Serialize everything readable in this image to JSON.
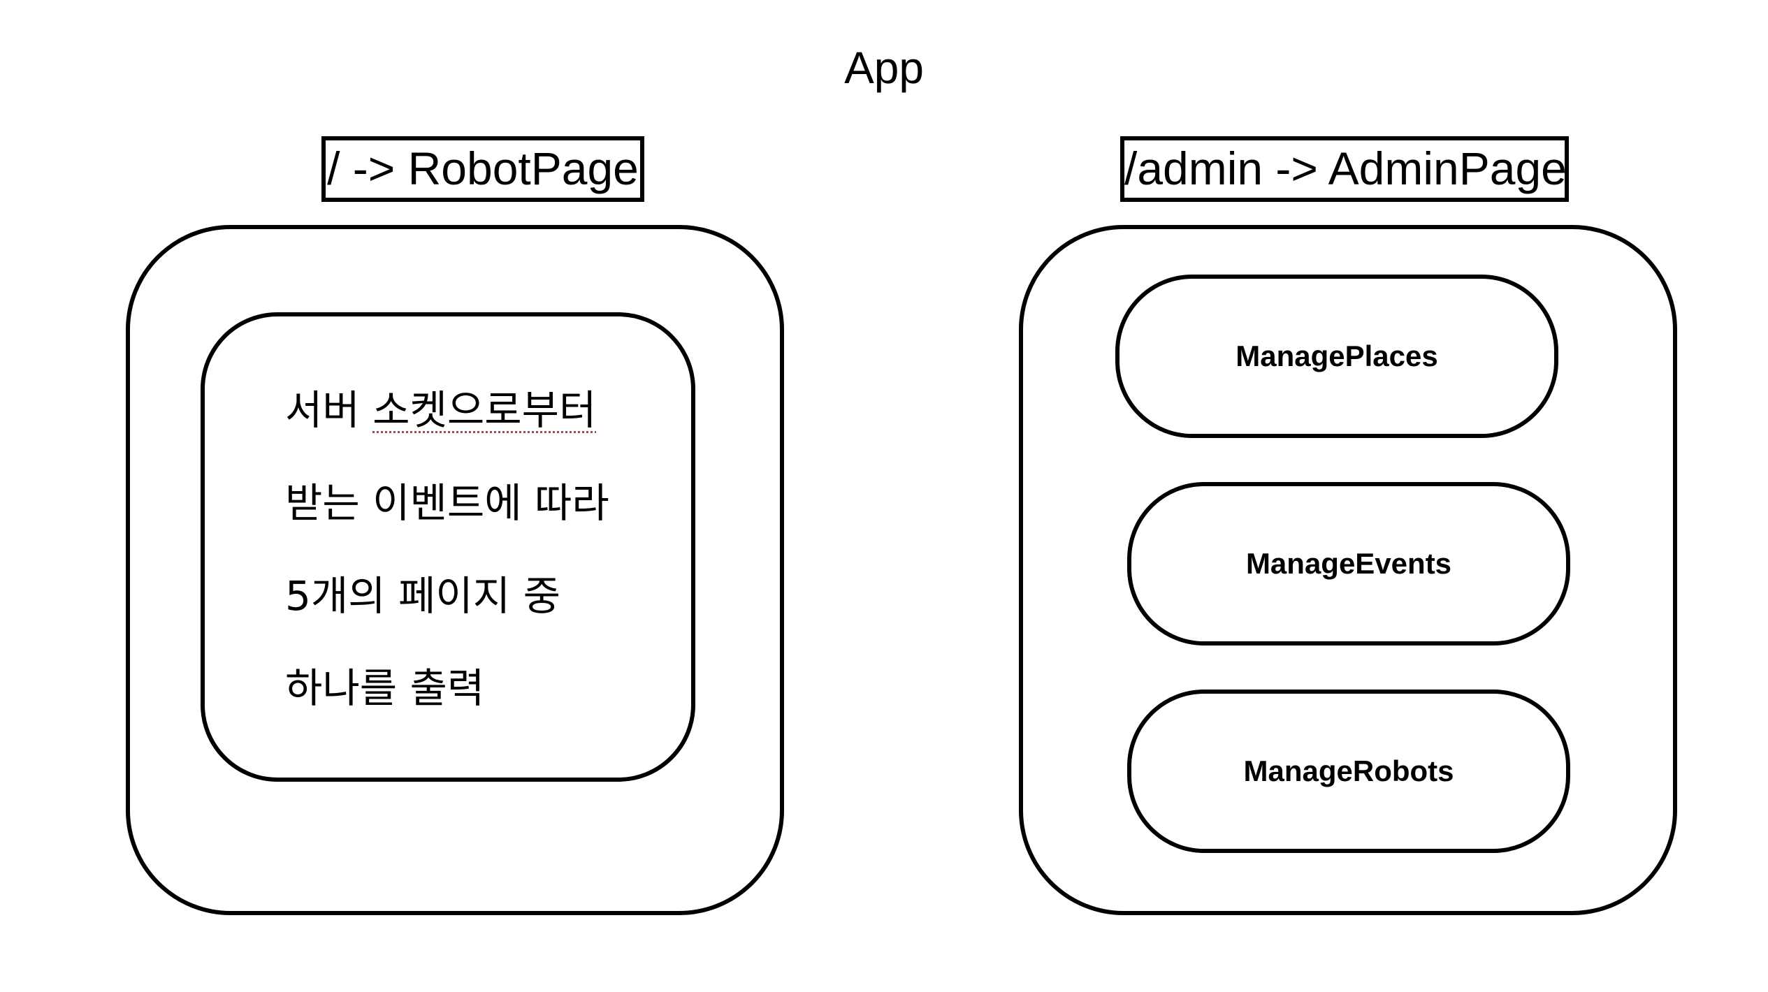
{
  "diagram": {
    "title": "App",
    "robot_route": {
      "label": "/ -> RobotPage",
      "description_lines": [
        {
          "plain": "서버 ",
          "underlined": "소켓으로부터"
        },
        {
          "plain": "받는 이벤트에 따라",
          "underlined": ""
        },
        {
          "plain": "5개의 페이지 중",
          "underlined": ""
        },
        {
          "plain": "하나를 출력",
          "underlined": ""
        }
      ]
    },
    "admin_route": {
      "label": "/admin -> AdminPage",
      "components": [
        {
          "label": "ManagePlaces"
        },
        {
          "label": "ManageEvents"
        },
        {
          "label": "ManageRobots"
        }
      ]
    },
    "colors": {
      "stroke": "#000000",
      "background": "#ffffff",
      "spellcheck_underline": "#e0322c"
    }
  }
}
